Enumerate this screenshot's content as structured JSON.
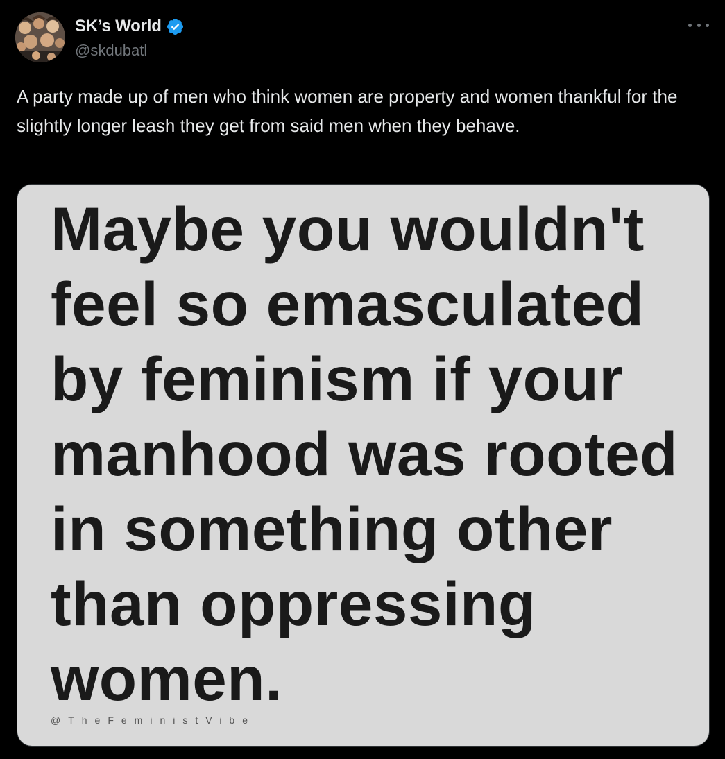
{
  "author": {
    "display_name": "SK’s World",
    "handle": "@skdubatl",
    "verified_icon": "verified-badge-icon",
    "avatar_icon": "profile-avatar"
  },
  "menu": {
    "more_icon": "more-options-icon"
  },
  "tweet": {
    "text": "A party made up of men who think women are property and women thankful for the slightly longer leash they get from said men when they behave."
  },
  "media": {
    "quote_text": "Maybe you wouldn't feel so emasculated by feminism if your manhood was rooted in something other than oppressing women.",
    "watermark": "@TheFeministVibe"
  },
  "colors": {
    "background": "#000000",
    "text_primary": "#e7e9ea",
    "text_secondary": "#71767b",
    "verified_blue": "#1d9bf0",
    "image_background": "#d9d9d9"
  }
}
